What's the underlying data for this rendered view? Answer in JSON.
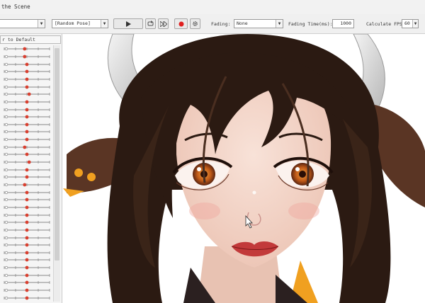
{
  "window": {
    "scene_title": "the Scene"
  },
  "toolbar": {
    "first_select": "",
    "pose_select": "[Random Pose]",
    "fading_label": "Fading:",
    "fading_value": "None",
    "fading_time_label": "Fading Time(ms):",
    "fading_time_value": "1000",
    "fps_label": "Calculate FPS",
    "fps_value": "60",
    "icons": [
      "play-icon",
      "loop-icon",
      "skip-forward-icon",
      "record-icon",
      "gear-icon"
    ],
    "record_color": "#e02020"
  },
  "left_panel": {
    "reset_label": "r to Default",
    "knob_color": "#d84030",
    "slider_rows": 34
  },
  "canvas": {
    "hair_color": "#2b1a12",
    "horn_color": "#d6d6d6",
    "ear_color": "#5a3524",
    "accent_orange": "#f0a020",
    "skin_color": "#f4d8cc",
    "iris_color": "#c05a18",
    "lip_color": "#c23a3a"
  }
}
